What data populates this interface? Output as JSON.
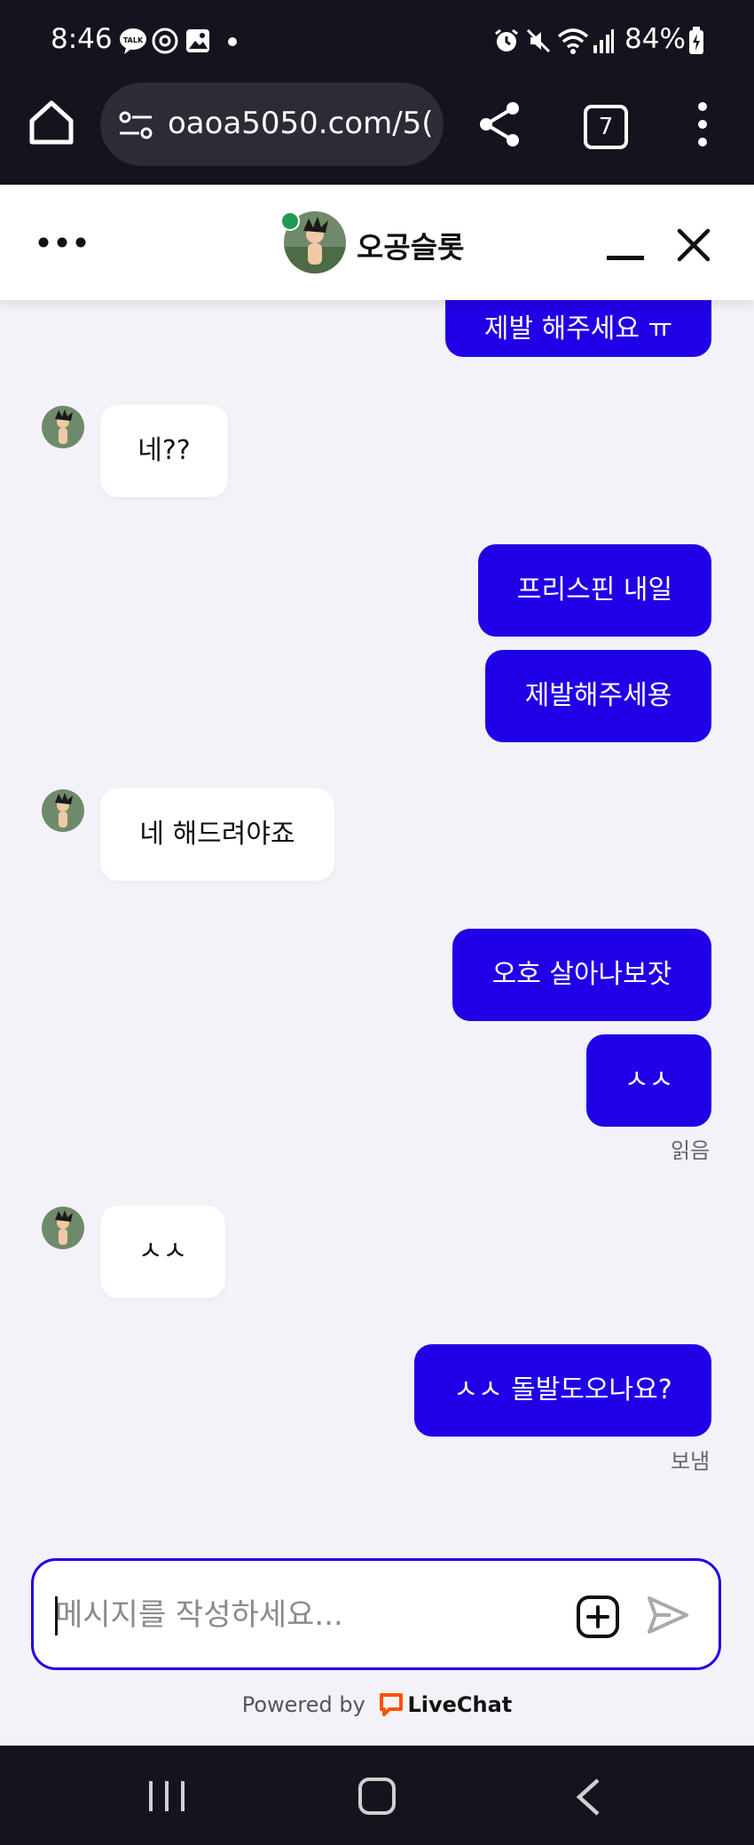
{
  "status_bar": {
    "time": "8:46",
    "battery": "84%",
    "icons": [
      "kakaotalk-icon",
      "threads-icon",
      "gallery-icon",
      "dot-icon",
      "alarm-icon",
      "mute-icon",
      "wifi-icon",
      "signal-icon",
      "battery-charging-icon"
    ]
  },
  "browser": {
    "url": "oaoa5050.com/5(",
    "tab_count": "7"
  },
  "chat": {
    "title": "오공슬롯",
    "messages": [
      {
        "dir": "out",
        "text": "제발 해주세요 ㅠ"
      },
      {
        "dir": "in",
        "text": "네??"
      },
      {
        "dir": "out",
        "text": "프리스핀 내일"
      },
      {
        "dir": "out",
        "text": "제발해주세용"
      },
      {
        "dir": "in",
        "text": "네 해드려야죠"
      },
      {
        "dir": "out",
        "text": "오호 살아나보잣"
      },
      {
        "dir": "out",
        "text": "ㅅㅅ"
      },
      {
        "dir": "in",
        "text": "ㅅㅅ"
      },
      {
        "dir": "out",
        "text": "ㅅㅅ 돌발도오나요?"
      }
    ],
    "read_status": "읽음",
    "sent_status": "보냄",
    "input_placeholder": "메시지를 작성하세요...",
    "powered_by": "Powered by",
    "powered_brand": "LiveChat"
  },
  "colors": {
    "accent": "#2000e6",
    "online": "#1f9a52",
    "livechat_orange": "#ff5100"
  }
}
